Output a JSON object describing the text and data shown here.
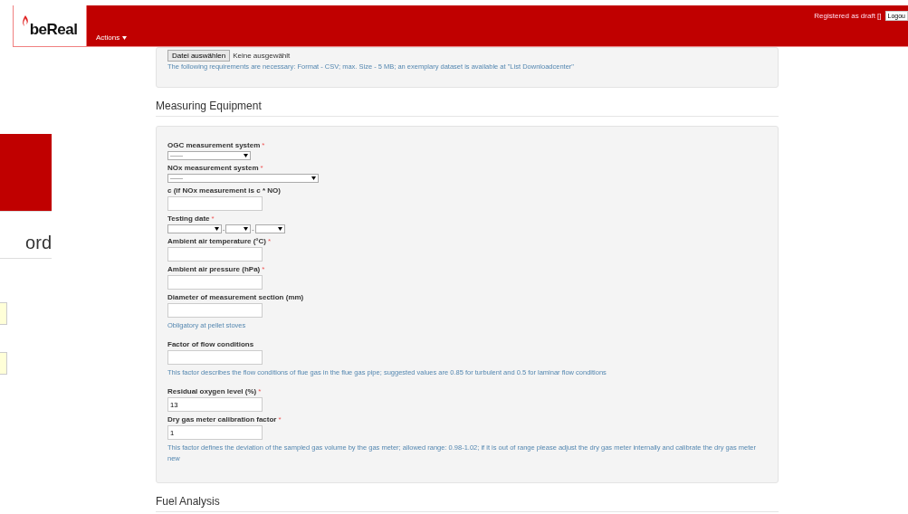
{
  "header": {
    "logo": "beReal",
    "menu": "Actions",
    "status": "Registered as draft []",
    "logout": "Logou"
  },
  "side": {
    "heading": "ord",
    "fields": [
      {
        "kind": "autofill"
      },
      {
        "kind": "autofill"
      }
    ]
  },
  "upload": {
    "button": "Datei auswählen",
    "status": "Keine ausgewählt",
    "help": "The following requirements are necessary: Format - CSV; max. Size - 5 MB; an exemplary dataset is available at \"List Downloadcenter\""
  },
  "required_mark": "*",
  "sections": [
    {
      "title": "Measuring Equipment",
      "fields": [
        {
          "kind": "select",
          "label": "OGC measurement system",
          "required": true,
          "value": "-------"
        },
        {
          "kind": "wide-select",
          "label": "NOx measurement system",
          "required": true,
          "value": "-------"
        },
        {
          "kind": "input",
          "label": "c (if NOx measurement is c * NO)",
          "required": false
        },
        {
          "kind": "date",
          "label": "Testing date",
          "required": true,
          "separators": [
            "-",
            "-"
          ]
        },
        {
          "kind": "input",
          "label": "Ambient air temperature (°C)",
          "required": true
        },
        {
          "kind": "input",
          "label": "Ambient air pressure (hPa)",
          "required": true
        },
        {
          "kind": "input",
          "label": "Diameter of measurement section (mm)",
          "required": false,
          "help": "Obligatory at pellet stoves"
        },
        {
          "kind": "input",
          "label": "Factor of flow conditions",
          "required": false,
          "help": "This factor describes the flow conditions of flue gas in the flue gas pipe; suggested values are 0.85 for turbulent and 0.5 for laminar flow conditions"
        },
        {
          "kind": "input",
          "label": "Residual oxygen level (%)",
          "required": true,
          "value": "13"
        },
        {
          "kind": "input",
          "label": "Dry gas meter calibration factor",
          "required": true,
          "value": "1",
          "help": "This factor defines the deviation of the sampled gas volume by the gas meter; allowed range: 0.98-1.02; if it is out of range please adjust the dry gas meter internally and calibrate the dry gas meter new"
        }
      ]
    },
    {
      "title": "Fuel Analysis"
    }
  ]
}
